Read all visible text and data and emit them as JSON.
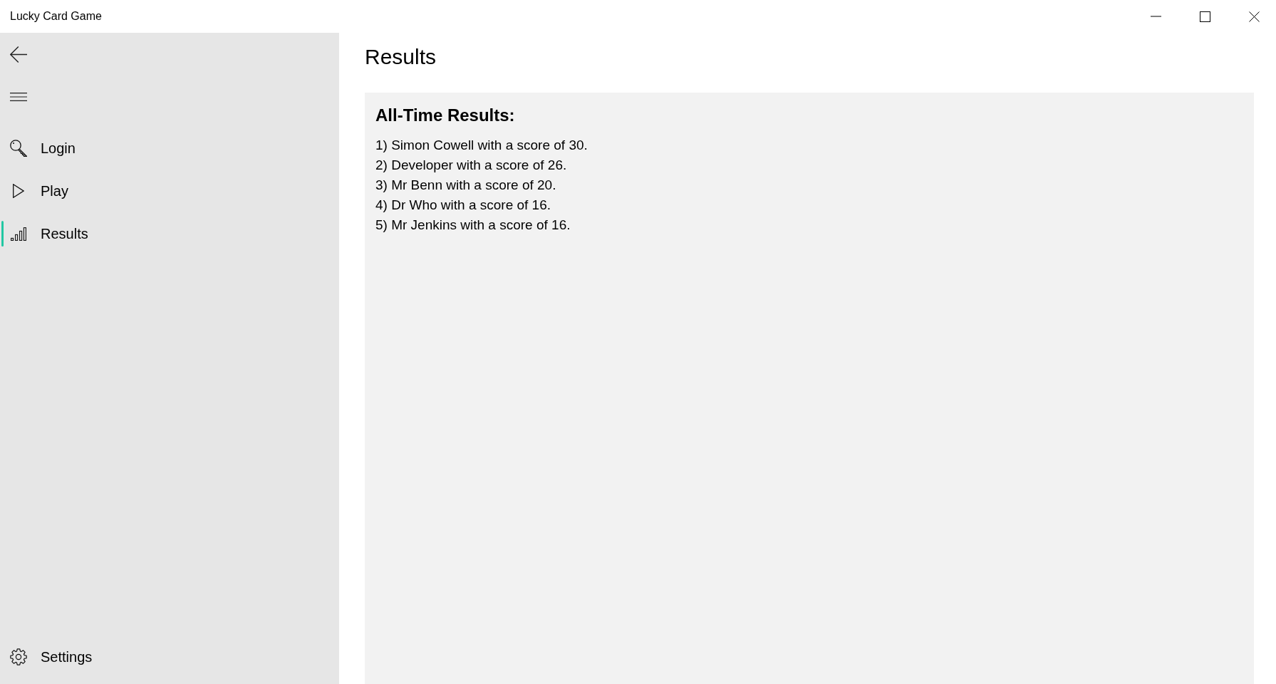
{
  "window": {
    "title": "Lucky Card Game"
  },
  "nav": {
    "items": [
      {
        "label": "Login",
        "kind": "key",
        "selected": false
      },
      {
        "label": "Play",
        "kind": "play",
        "selected": false
      },
      {
        "label": "Results",
        "kind": "bars",
        "selected": true
      }
    ],
    "footer_items": [
      {
        "label": "Settings",
        "kind": "gear",
        "selected": false
      }
    ]
  },
  "page": {
    "title": "Results"
  },
  "results": {
    "heading": "All-Time Results:",
    "entries": [
      "1) Simon Cowell with a score of 30.",
      "2) Developer with a score of 26.",
      "3) Mr Benn with a score of 20.",
      "4) Dr Who with a score of 16.",
      "5) Mr Jenkins with a score of 16."
    ]
  }
}
